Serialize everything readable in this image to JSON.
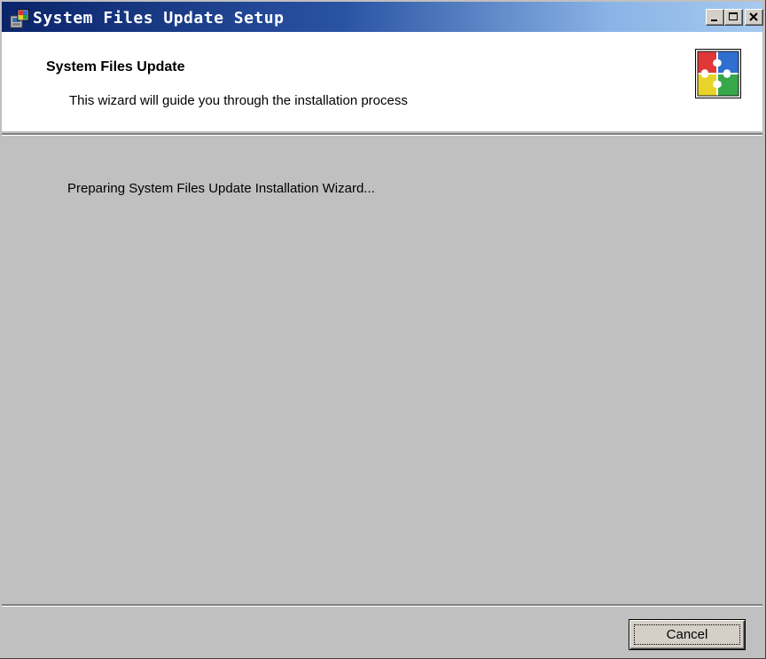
{
  "window": {
    "title": "System Files Update Setup",
    "icon": "setup-icon",
    "controls": {
      "minimize": "minimize-icon",
      "maximize": "maximize-icon",
      "close": "close-icon"
    }
  },
  "header": {
    "title": "System Files Update",
    "subtitle": "This wizard will guide you through the installation process",
    "logo": "puzzle-icon"
  },
  "content": {
    "status_text": "Preparing System Files Update Installation Wizard..."
  },
  "footer": {
    "cancel_label": "Cancel"
  },
  "colors": {
    "titlebar_start": "#0a246a",
    "titlebar_end": "#a6caf0",
    "dialog_bg": "#c0c0c0",
    "header_bg": "#ffffff"
  }
}
